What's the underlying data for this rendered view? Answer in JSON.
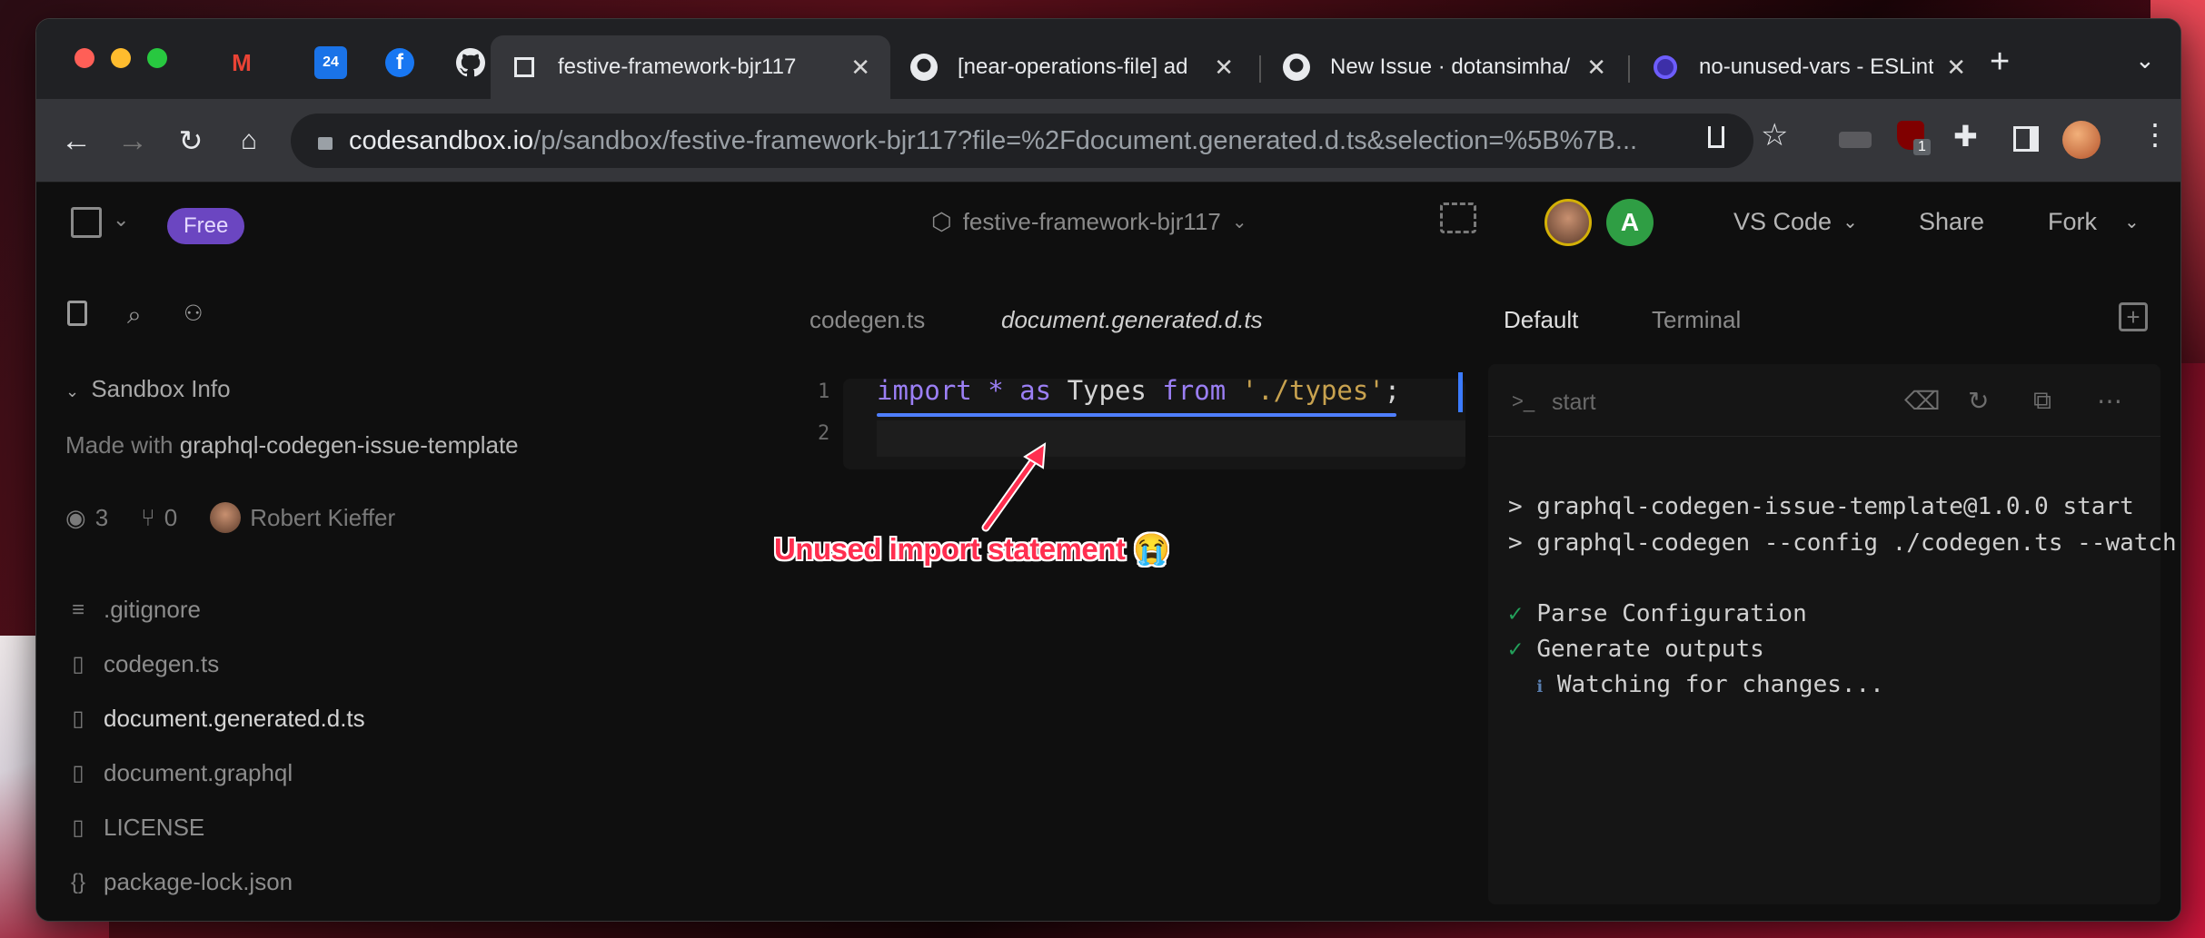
{
  "browser": {
    "tabs": [
      {
        "title": "festive-framework-bjr117"
      },
      {
        "title": "[near-operations-file] ad"
      },
      {
        "title": "New Issue · dotansimha/"
      },
      {
        "title": "no-unused-vars - ESLint"
      }
    ],
    "pinned": {
      "calendar_day": "24"
    },
    "extension_badge": "1",
    "url": {
      "host": "codesandbox.io",
      "path": "/p/sandbox/festive-framework-bjr117?file=%2Fdocument.generated.d.ts&selection=%5B%7B..."
    }
  },
  "app": {
    "plan_badge": "Free",
    "sandbox_name": "festive-framework-bjr117",
    "avatar_initial": "A",
    "editor_menu": "VS Code",
    "share_label": "Share",
    "fork_label": "Fork"
  },
  "sidebar": {
    "section_title": "Sandbox Info",
    "made_with_prefix": "Made with",
    "template_name": "graphql-codegen-issue-template",
    "views": "3",
    "forks": "0",
    "author": "Robert Kieffer",
    "files": [
      {
        "name": ".gitignore",
        "icon": "lines-icon"
      },
      {
        "name": "codegen.ts",
        "icon": "file-icon"
      },
      {
        "name": "document.generated.d.ts",
        "icon": "file-icon"
      },
      {
        "name": "document.graphql",
        "icon": "file-icon"
      },
      {
        "name": "LICENSE",
        "icon": "file-icon"
      },
      {
        "name": "package-lock.json",
        "icon": "braces-icon"
      }
    ]
  },
  "editor": {
    "tabs": [
      "codegen.ts",
      "document.generated.d.ts"
    ],
    "line_numbers": [
      "1",
      "2"
    ],
    "code": {
      "kw_import": "import",
      "star": "*",
      "kw_as": "as",
      "ident": "Types",
      "kw_from": "from",
      "string": "'./types'",
      "semi": ";"
    },
    "annotation": "Unused import statement 😭"
  },
  "panel": {
    "tabs": [
      "Default",
      "Terminal"
    ],
    "terminal_title": "start",
    "lines": [
      "> graphql-codegen-issue-template@1.0.0 start",
      "> graphql-codegen --config ./codegen.ts --watch",
      "Parse Configuration",
      "Generate outputs",
      "Watching for changes..."
    ],
    "check_mark": "✓",
    "info_mark": "ℹ"
  },
  "colors": {
    "accent_purple": "#6b46c1",
    "keyword": "#9b7ff5",
    "string": "#c8a24f",
    "annotation_red": "#ff2e4f",
    "terminal_ok": "#23a05a"
  }
}
